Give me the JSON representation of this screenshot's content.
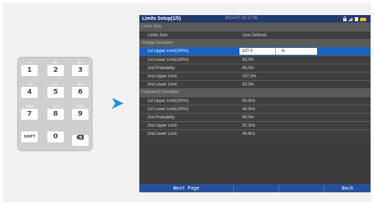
{
  "keypad": {
    "rows": [
      [
        {
          "sub": "+-x",
          "key": "1"
        },
        {
          "sub": "ABC",
          "key": "2"
        },
        {
          "sub": "DEF",
          "key": "3"
        }
      ],
      [
        {
          "sub": "GHI",
          "key": "4"
        },
        {
          "sub": "JKL",
          "key": "5"
        },
        {
          "sub": "MNO",
          "key": "6"
        }
      ],
      [
        {
          "sub": "PQRS",
          "key": "7"
        },
        {
          "sub": "TUV",
          "key": "8"
        },
        {
          "sub": "WXYZ",
          "key": "9"
        }
      ],
      [
        {
          "sub": "",
          "key": "SHIFT"
        },
        {
          "sub": "_",
          "key": "0"
        },
        {
          "sub": "",
          "key": "⌫"
        }
      ]
    ]
  },
  "screen": {
    "title": "Limits Setup(1/5)",
    "datetime": "2014-07-23 17:05",
    "status_icons": [
      "lock-icon",
      "signal-icon",
      "sd-card-icon",
      "battery-icon"
    ],
    "sections": {
      "limits_sets": "Limits Sets",
      "voltage": "Voltage Deviation",
      "frequency": "Frequency Deviation"
    },
    "limits_sets_row": {
      "label": "Limits Sets",
      "value": "User Defined"
    },
    "voltage_rows": [
      {
        "label": "1st Upper Limit(100%)",
        "value": "107.0",
        "unit": "%",
        "editing": true
      },
      {
        "label": "1st Lower Limit(100%)",
        "value": "93.0%"
      },
      {
        "label": "2nd Probability",
        "value": "95.0%"
      },
      {
        "label": "2nd Upper Limit",
        "value": "107.0%"
      },
      {
        "label": "2nd Lower Limit",
        "value": "93.0%"
      }
    ],
    "frequency_rows": [
      {
        "label": "1st Upper Limit(100%)",
        "value": "50.5Hz"
      },
      {
        "label": "1st Lower Limit(100%)",
        "value": "49.5Hz"
      },
      {
        "label": "2nd Probability",
        "value": "95.0%"
      },
      {
        "label": "2nd Upper Limit",
        "value": "50.2Hz"
      },
      {
        "label": "2nd Lower Limit",
        "value": "49.8Hz"
      }
    ],
    "footer": {
      "next_page": "Next Page",
      "back": "Back"
    }
  }
}
